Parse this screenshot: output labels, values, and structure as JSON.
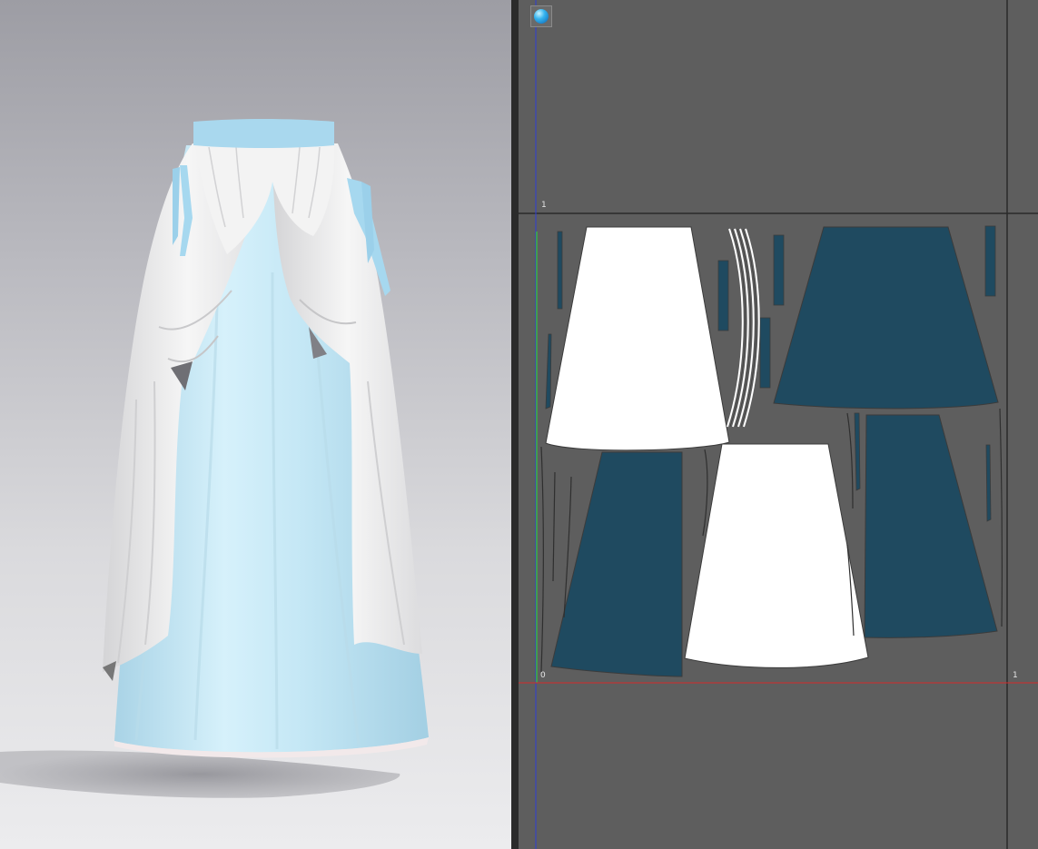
{
  "viewport": {
    "garment": "skirt",
    "colors": {
      "background_top": "#9d9da4",
      "background_bottom": "#ececee",
      "underskirt": "#c9e9f5",
      "waistband": "#a9d8ee",
      "overskirt_drape": "#eeeeee",
      "ribbons": "#a6d8ef",
      "shadow": "#9a9aa0"
    }
  },
  "uv_editor": {
    "sphere_button_icon": "sphere-icon",
    "tick_labels": {
      "top_left": "1",
      "bottom_left": "0",
      "bottom_right": "1"
    },
    "colors": {
      "background": "#5e5e5e",
      "white_piece": "#ffffff",
      "teal_piece": "#1f4a60",
      "axis_x": "#d42a2a",
      "axis_y_green": "#3db53d",
      "axis_y_blue": "#2e3ed6",
      "grid_line": "#2a2a2a"
    }
  }
}
